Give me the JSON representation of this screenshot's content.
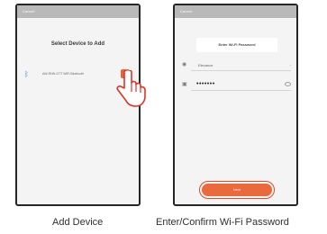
{
  "screen1": {
    "status": "Cancel",
    "title": "Select Device to Add",
    "device": {
      "name": "AW-RNN-OTT WiFi-Bluetooth",
      "add_icon": "plus-icon"
    },
    "caption": "Add Device"
  },
  "screen2": {
    "status": "Cancel",
    "title": "Enter Wi-Fi Password",
    "network": "Elevance",
    "password_masked": "•••••••",
    "next_label": "Next",
    "caption": "Enter/Confirm Wi-Fi Password"
  },
  "colors": {
    "accent": "#e8643a",
    "status_bar": "#b9b9b9",
    "frame": "#262626"
  }
}
